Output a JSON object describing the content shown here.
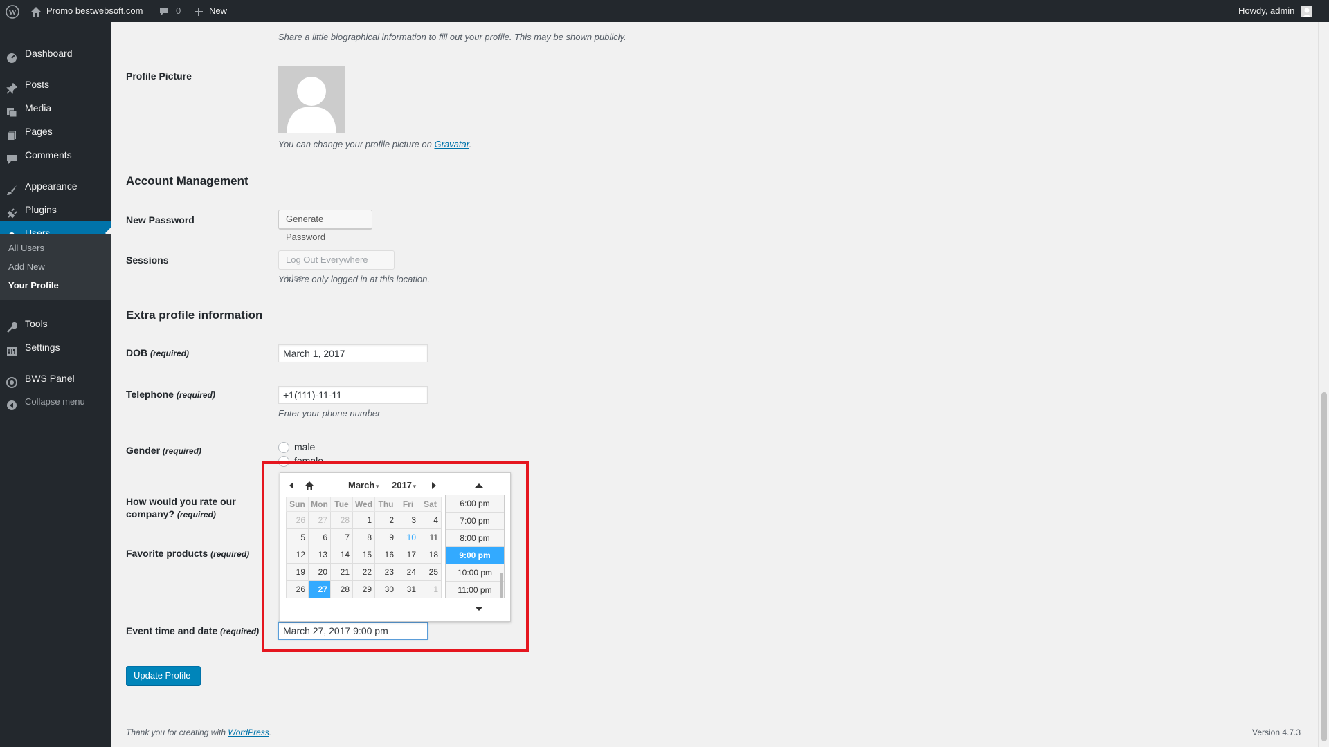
{
  "adminbar": {
    "site_name": "Promo bestwebsoft.com",
    "comments_count": "0",
    "new_label": "New",
    "howdy": "Howdy, admin"
  },
  "sidebar": {
    "items": [
      {
        "label": "Dashboard",
        "icon": "dashboard-icon"
      },
      {
        "label": "Posts",
        "icon": "pin-icon"
      },
      {
        "label": "Media",
        "icon": "media-icon"
      },
      {
        "label": "Pages",
        "icon": "page-icon"
      },
      {
        "label": "Comments",
        "icon": "comment-icon"
      },
      {
        "label": "Appearance",
        "icon": "brush-icon"
      },
      {
        "label": "Plugins",
        "icon": "plug-icon"
      },
      {
        "label": "Users",
        "icon": "user-icon"
      },
      {
        "label": "Tools",
        "icon": "wrench-icon"
      },
      {
        "label": "Settings",
        "icon": "settings-icon"
      },
      {
        "label": "BWS Panel",
        "icon": "bws-icon"
      },
      {
        "label": "Collapse menu",
        "icon": "collapse-icon"
      }
    ],
    "submenu": [
      "All Users",
      "Add New",
      "Your Profile"
    ]
  },
  "bio": {
    "description": "Share a little biographical information to fill out your profile. This may be shown publicly."
  },
  "profile_picture": {
    "label": "Profile Picture",
    "desc_prefix": "You can change your profile picture on ",
    "link": "Gravatar",
    "desc_suffix": "."
  },
  "account": {
    "title": "Account Management",
    "new_password_label": "New Password",
    "generate_button": "Generate Password",
    "sessions_label": "Sessions",
    "logout_button": "Log Out Everywhere Else",
    "sessions_desc": "You are only logged in at this location."
  },
  "extra": {
    "title": "Extra profile information",
    "required": "(required)",
    "dob_label": "DOB",
    "dob_value": "March 1, 2017",
    "phone_label": "Telephone",
    "phone_value": "+1(111)-11-11",
    "phone_desc": "Enter your phone number",
    "gender_label": "Gender",
    "gender_male": "male",
    "gender_female": "female",
    "rate_label_1": "How would you rate our",
    "rate_label_2": "company?",
    "favorite_label": "Favorite products",
    "event_label": "Event time and date",
    "event_value": "March 27, 2017 9:00 pm"
  },
  "datepicker": {
    "month": "March",
    "year": "2017",
    "weekdays": [
      "Sun",
      "Mon",
      "Tue",
      "Wed",
      "Thu",
      "Fri",
      "Sat"
    ],
    "weeks": [
      [
        "26",
        "27",
        "28",
        "1",
        "2",
        "3",
        "4"
      ],
      [
        "5",
        "6",
        "7",
        "8",
        "9",
        "10",
        "11"
      ],
      [
        "12",
        "13",
        "14",
        "15",
        "16",
        "17",
        "18"
      ],
      [
        "19",
        "20",
        "21",
        "22",
        "23",
        "24",
        "25"
      ],
      [
        "26",
        "27",
        "28",
        "29",
        "30",
        "31",
        "1"
      ]
    ],
    "times": [
      "6:00 pm",
      "7:00 pm",
      "8:00 pm",
      "9:00 pm",
      "10:00 pm",
      "11:00 pm"
    ],
    "selected_time": "9:00 pm",
    "selected_day": "27",
    "today": "10"
  },
  "update_button": "Update Profile",
  "footer": {
    "thanks_prefix": "Thank you for creating with ",
    "thanks_link": "WordPress",
    "thanks_suffix": ".",
    "version": "Version 4.7.3"
  },
  "colors": {
    "adminbar_bg": "#23282d",
    "accent": "#0073aa",
    "picker_selected": "#33aaff",
    "highlight": "#e5161f"
  }
}
